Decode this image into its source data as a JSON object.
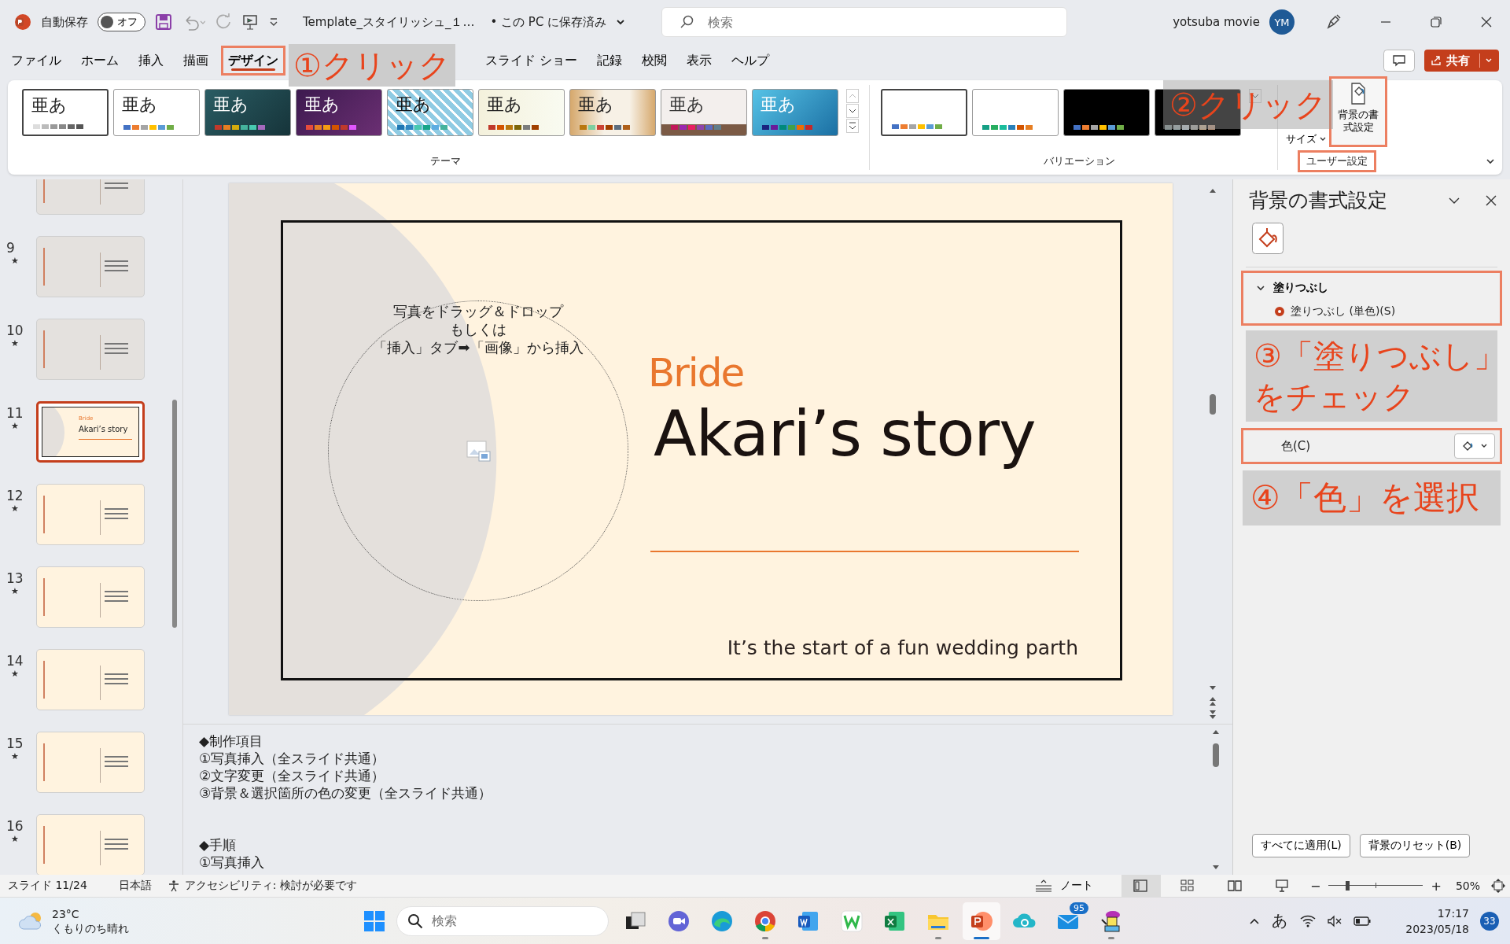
{
  "title_bar": {
    "autosave_label": "自動保存",
    "autosave_toggle": {
      "label": "オフ",
      "on": false
    },
    "file_name": "Template_スタイリッシュ_１…",
    "save_status": "• この PC に保存済み",
    "search": {
      "placeholder": "検索"
    },
    "user_name": "yotsuba movie",
    "avatar": "YM"
  },
  "share_button": "共有",
  "tabs": [
    {
      "kind": "tab",
      "label": "ファイル",
      "selected": false,
      "highlighted": false
    },
    {
      "kind": "tab",
      "label": "ホーム",
      "selected": false,
      "highlighted": false
    },
    {
      "kind": "tab",
      "label": "挿入",
      "selected": false,
      "highlighted": false
    },
    {
      "kind": "tab",
      "label": "描画",
      "selected": false,
      "highlighted": false
    },
    {
      "kind": "tab",
      "label": "デザイン",
      "selected": true,
      "highlighted": true
    },
    {
      "kind": "callout",
      "label": "①クリック"
    },
    {
      "kind": "tab",
      "label": "スライド ショー",
      "selected": false,
      "highlighted": false
    },
    {
      "kind": "tab",
      "label": "記録",
      "selected": false,
      "highlighted": false
    },
    {
      "kind": "tab",
      "label": "校閲",
      "selected": false,
      "highlighted": false
    },
    {
      "kind": "tab",
      "label": "表示",
      "selected": false,
      "highlighted": false
    },
    {
      "kind": "tab",
      "label": "ヘルプ",
      "selected": false,
      "highlighted": false
    }
  ],
  "ribbon": {
    "themes": [
      {
        "kind": "plain",
        "label": "亜あ",
        "selected": true
      },
      {
        "kind": "white",
        "label": "亜あ",
        "selected": false
      },
      {
        "kind": "teal",
        "label": "亜あ",
        "selected": false
      },
      {
        "kind": "purple",
        "label": "亜あ",
        "selected": false
      },
      {
        "kind": "pattern",
        "label": "亜あ",
        "selected": false
      },
      {
        "kind": "cream",
        "label": "亜あ",
        "selected": false
      },
      {
        "kind": "wood",
        "label": "亜あ",
        "selected": false
      },
      {
        "kind": "slate",
        "label": "亜あ",
        "selected": false
      },
      {
        "kind": "sky",
        "label": "亜あ",
        "selected": false
      }
    ],
    "themes_group": "テーマ",
    "variations": [
      {
        "kind": "white",
        "selected": true
      },
      {
        "kind": "white2",
        "selected": false
      },
      {
        "kind": "black",
        "selected": false
      },
      {
        "kind": "black2",
        "selected": false
      }
    ],
    "variations_group": "バリエーション",
    "slide_size": "サイズ",
    "format_background": {
      "label": "背景の書式設定",
      "highlighted": true
    },
    "customize_group": {
      "label": "ユーザー設定",
      "highlighted": true
    },
    "callout": "②クリック"
  },
  "slides": [
    {
      "kind": "gray",
      "selected": false
    },
    {
      "number": "9",
      "star": "★",
      "kind": "gray",
      "selected": false
    },
    {
      "number": "10",
      "star": "★",
      "kind": "gray",
      "selected": false
    },
    {
      "number": "11",
      "star": "★",
      "kind": "title",
      "selected": true,
      "kicker": "Bride",
      "title": "Akari’s story"
    },
    {
      "number": "12",
      "star": "★",
      "kind": "cream",
      "selected": false
    },
    {
      "number": "13",
      "star": "★",
      "kind": "cream",
      "selected": false
    },
    {
      "number": "14",
      "star": "★",
      "kind": "cream",
      "selected": false
    },
    {
      "number": "15",
      "star": "★",
      "kind": "cream",
      "selected": false
    },
    {
      "number": "16",
      "star": "★",
      "kind": "cream",
      "selected": false
    }
  ],
  "slide": {
    "placeholder_lines": [
      "写真をドラッグ＆ドロップ",
      "もしくは",
      "「挿入」タブ➡「画像」から挿入"
    ],
    "kicker": "Bride",
    "title": "Akari’s story",
    "subtitle": "It’s the start of a fun wedding parth"
  },
  "notes": [
    [
      "◆制作項目",
      "①写真挿入（全スライド共通）",
      "②文字変更（全スライド共通）",
      "③背景＆選択箇所の色の変更（全スライド共通）"
    ],
    [
      "◆手順",
      "①写真挿入"
    ]
  ],
  "format_pane": {
    "title": "背景の書式設定",
    "section": {
      "label": "塗りつぶし",
      "expanded": true,
      "highlighted": true
    },
    "options": [
      {
        "label": "塗りつぶし (単色)(S)",
        "selected": true
      }
    ],
    "callouts": [
      [
        "③「塗りつぶし」",
        "をチェック"
      ],
      [
        "④「色」を選択"
      ]
    ],
    "color_row": {
      "label": "色(C)",
      "highlighted": true
    },
    "buttons": [
      "すべてに適用(L)",
      "背景のリセット(B)"
    ]
  },
  "status_bar": {
    "slide": "スライド 11/24",
    "language": "日本語",
    "accessibility": "アクセシビリティ: 検討が必要です",
    "notes": "ノート",
    "views": [
      {
        "kind": "normal",
        "selected": true
      },
      {
        "kind": "sorter",
        "selected": false
      },
      {
        "kind": "reading",
        "selected": false
      },
      {
        "kind": "show",
        "selected": false
      }
    ],
    "zoom": {
      "out": "−",
      "level": 0.2,
      "in": "+",
      "reading": "50%"
    }
  },
  "taskbar": {
    "weather": {
      "temp": "23°C",
      "text": "くもりのち晴れ"
    },
    "search": {
      "placeholder": "検索"
    },
    "apps": [
      {
        "kind": "taskview",
        "running": false,
        "selected": false
      },
      {
        "kind": "chat",
        "running": false,
        "selected": false
      },
      {
        "kind": "edge",
        "running": false,
        "selected": false
      },
      {
        "kind": "chrome",
        "running": true,
        "selected": false
      },
      {
        "kind": "word",
        "running": false,
        "selected": false
      },
      {
        "kind": "writer",
        "running": false,
        "selected": false
      },
      {
        "kind": "excel",
        "running": false,
        "selected": false
      },
      {
        "kind": "folder",
        "running": true,
        "selected": false
      },
      {
        "kind": "powerpoint",
        "running": true,
        "selected": true
      },
      {
        "kind": "cloud",
        "running": false,
        "selected": false
      },
      {
        "kind": "mail",
        "running": false,
        "selected": false,
        "badge": "95"
      },
      {
        "kind": "paint",
        "running": true,
        "selected": false
      }
    ],
    "tray": {
      "ime": "あ",
      "time": "17:17",
      "date": "2023/05/18",
      "notifications": "33"
    }
  }
}
